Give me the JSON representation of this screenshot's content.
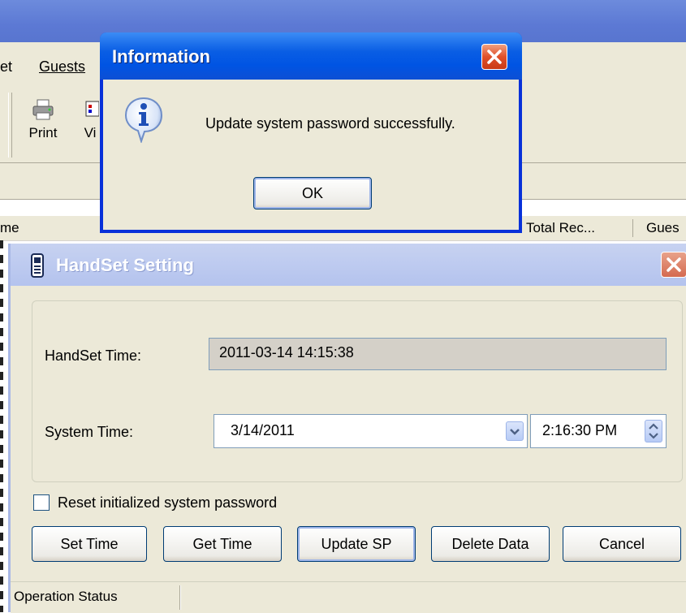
{
  "main_window": {
    "menu": [
      "et",
      "Guests"
    ],
    "toolbar": [
      {
        "label": "Print",
        "icon": "printer-icon"
      },
      {
        "label": "Vi",
        "icon": "view-icon"
      }
    ],
    "list_columns": [
      "me",
      "Total Rec...",
      "Gues"
    ]
  },
  "info_dialog": {
    "title": "Information",
    "message": "Update system password successfully.",
    "ok_label": "OK",
    "icon": "info-icon"
  },
  "handset_dialog": {
    "title": "HandSet Setting",
    "handset_time_label": "HandSet Time:",
    "handset_time_value": "2011-03-14 14:15:38",
    "system_time_label": "System Time:",
    "system_date_value": "3/14/2011",
    "system_time_value": "2:16:30 PM",
    "reset_checkbox_label": "Reset initialized system password",
    "reset_checked": false,
    "buttons": {
      "set_time": "Set Time",
      "get_time": "Get Time",
      "update_sp": "Update SP",
      "delete_data": "Delete Data",
      "cancel": "Cancel"
    },
    "status_text": "Operation Status"
  },
  "colors": {
    "xp_face": "#ece9d8",
    "active_title": "#0054e3",
    "inactive_title": "#b4c3ee",
    "button_border": "#003c74"
  }
}
